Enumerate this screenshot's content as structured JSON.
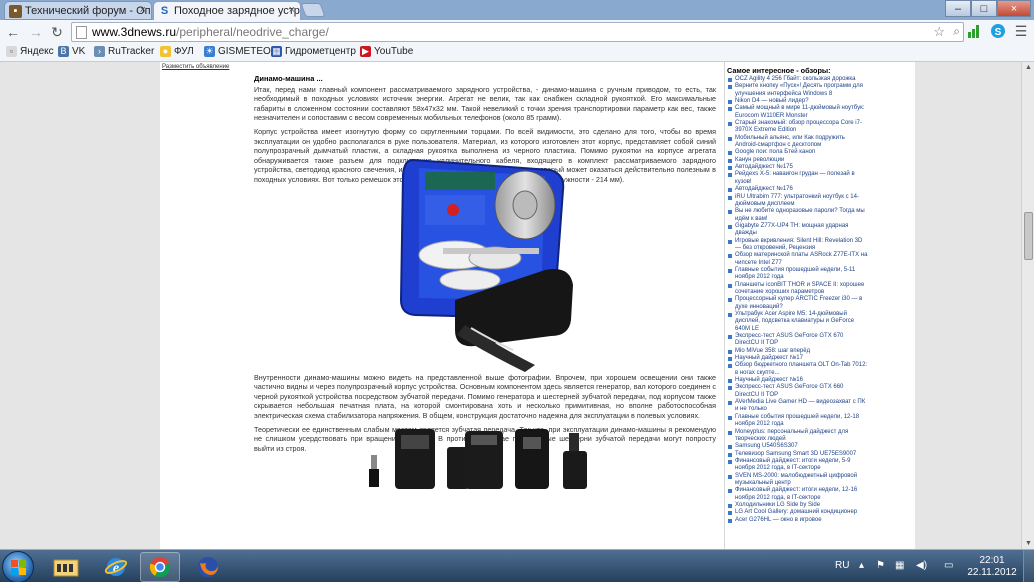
{
  "browser": {
    "tabs": [
      {
        "label": "Технический форум - Оп",
        "icon": "forum-icon",
        "active": false
      },
      {
        "label": "Походное зарядное устр",
        "icon": "3dnews-icon",
        "active": true
      }
    ],
    "close_glyph": "×",
    "window_controls": {
      "minimize": "–",
      "maximize": "□",
      "close": "×"
    },
    "nav": {
      "back": "←",
      "forward": "→",
      "reload": "↻"
    },
    "url": {
      "domain": "www.3dnews.ru",
      "path": "/peripheral/neodrive_charge/"
    }
  },
  "bookmarks": [
    {
      "label": "Яндекс",
      "icon": "yandex-icon",
      "color": "#d9d9d9"
    },
    {
      "label": "VK",
      "icon": "vk-icon",
      "color": "#4a76a8"
    },
    {
      "label": "RuTracker",
      "icon": "rutracker-icon",
      "color": "#6b8fb4"
    },
    {
      "label": "ФУЛ",
      "icon": "bulb-icon",
      "color": "#f2c230"
    },
    {
      "label": "GISMETEO",
      "icon": "gismeteo-icon",
      "color": "#3a7fd4"
    },
    {
      "label": "Гидрометцентр",
      "icon": "hydromet-icon",
      "color": "#2f58a8"
    },
    {
      "label": "YouTube",
      "icon": "youtube-icon",
      "color": "#cc181e"
    }
  ],
  "page": {
    "ad_link": "Разместить объявление",
    "article": {
      "heading": "Динамо-машина ...",
      "paragraphs": [
        "Итак, перед нами главный компонент рассматриваемого зарядного устройства, - динамо-машина с ручным приводом, то есть, так необходимый в походных условиях источник энергии. Агрегат не велик, так как снабжен складной рукояткой. Его максимальные габариты в сложенном состоянии составляют 58х47х32 мм. Такой невеликий с точки зрения транспортировки параметр как вес, также незначителен и сопоставим с весом современных мобильных телефонов (около 85 грамм).",
        "Корпус устройства имеет изогнутую форму со скругленными торцами. По всей видимости, это сделано для того, чтобы во время эксплуатации он удобно располагался в руке пользователя. Материал, из которого изготовлен этот корпус, представляет собой синий полупрозрачный дымчатый пластик, а складная рукоятка выполнена из черного пластика. Помимо рукоятки на корпусе агрегата обнаруживается также разъем для подключения удлинительного кабеля, входящего в комплект рассматриваемого зарядного устройства, светодиод красного свечения, и прикрепляемый ремешок на запястье, который может оказаться действительно полезным в походных условиях. Вот только ремешок этот, на мой взгляд, несколько маловат (длина окружности - 214 мм).",
        "Внутренности динамо-машины можно видеть на представленной выше фотографии. Впрочем, при хорошем освещении они также частично видны и через полупрозрачный корпус устройства. Основным компонентом здесь является генератор, вал которого соединен с черной рукояткой устройства посредством зубчатой передачи. Помимо генератора и шестерней зубчатой передачи, под корпусом также скрывается небольшая печатная плата, на которой смонтирована хоть и несколько примитивная, но вполне работоспособная электрическая схема стабилизатора напряжения. В общем, конструкция достаточно надежна для эксплуатации в полевых условиях.",
        "Теоретически ее единственным слабым местом является зубчатая передача. Так что, при эксплуатации динамо-машины я рекомендую не слишком усердствовать при вращении рукоятки. В противном случае пластиковые шестерни зубчатой передачи могут попросту выйти из строя."
      ]
    },
    "sidebar": {
      "title": "Самое интересное - обзоры:",
      "items": [
        "OCZ Agility 4 256 Гбайт: скользкая дорожка",
        "Верните кнопку «Пуск»! Десять программ для улучшения интерфейса Windows 8",
        "Nikon D4 — новый лидер?",
        "Самый мощный в мире 11-дюймовый ноутбук: Eurocom W110ER Monster",
        "Старый знакомый: обзор процессора Core i7-3970X Extreme Edition",
        "Мобильный альянс, или Как подружить Android-смартфон с десктопом",
        "Google пои: пола Бтей каноп",
        "Канун революции",
        "Автодайджест №175",
        "Рейдеxs X-5: наваигон грудан — полезай в кузов!",
        "Автодайджест №176",
        "iRU Ultrabim 777: ультратонкий ноутбук с 14-дюймовым дисплеем",
        "Вы не любите одноразовые пароли? Тогда мы идём к вам!",
        "Gigabyte Z77X-UP4 TH: мощная ударная дважды",
        "Игровые вкривления: Silent Hill: Revelation 3D — без откровений, Рецензия",
        "Обзор материнской платы ASRock Z77E-ITX на чипсете Intel Z77",
        "Главные события прошедшей недели, 5-11 ноября 2012 года",
        "Планшеты iconBIT THOR и SPACE II: хорошее сочетание хороших параметров",
        "Процессорный кулер ARCTIC Freezer i30 — в духе инноваций?",
        "Ультрабук Acer Aspire M5: 14-дюймовый дисплей, подсветка клавиатуры и GeForce 640M LE",
        "Экспресс-тест ASUS GeForce GTX 670 DirectCU II TOP",
        "Mio MiVue 358: шаг вперёд",
        "Научный дайджест №17",
        "Обзор бюджетного планшета OLT On-Tab 7012: в ногах скупте...",
        "Научный дайджест №16",
        "Экспресс-тест ASUS GeForce GTX 660 DirectCU II TOP",
        "AVerMedia Live Gamer HD — видеозахват с ПК и не только",
        "Главные события прошедшей недели, 12-18 ноября 2012 года",
        "Moneyplus: персональный дайджест для творческих людей",
        "Samsung U540S6S307",
        "Телевизор Samsung Smart 3D UE75ES9007",
        "Финансовый дайджест: итоги недели, 5-9 ноября 2012 года, в IT-секторе",
        "SVEN MS-2000: малобюджетный цифровой музыкальный центр",
        "Финансовый дайджест: итоги недели, 12-16 ноября 2012 года, в IT-секторе",
        "Холодильники LG Side by Side",
        "LG Art Cool Gallery: домашний кондиционер",
        "Acer G276HL — окно в игровое"
      ]
    }
  },
  "taskbar": {
    "apps": [
      {
        "icon": "windows-explorer-icon",
        "running": false
      },
      {
        "icon": "ie-icon",
        "running": false
      },
      {
        "icon": "chrome-icon",
        "running": true
      },
      {
        "icon": "firefox-icon",
        "running": false
      }
    ],
    "language": "RU",
    "time": "22:01",
    "date": "22.11.2012"
  }
}
